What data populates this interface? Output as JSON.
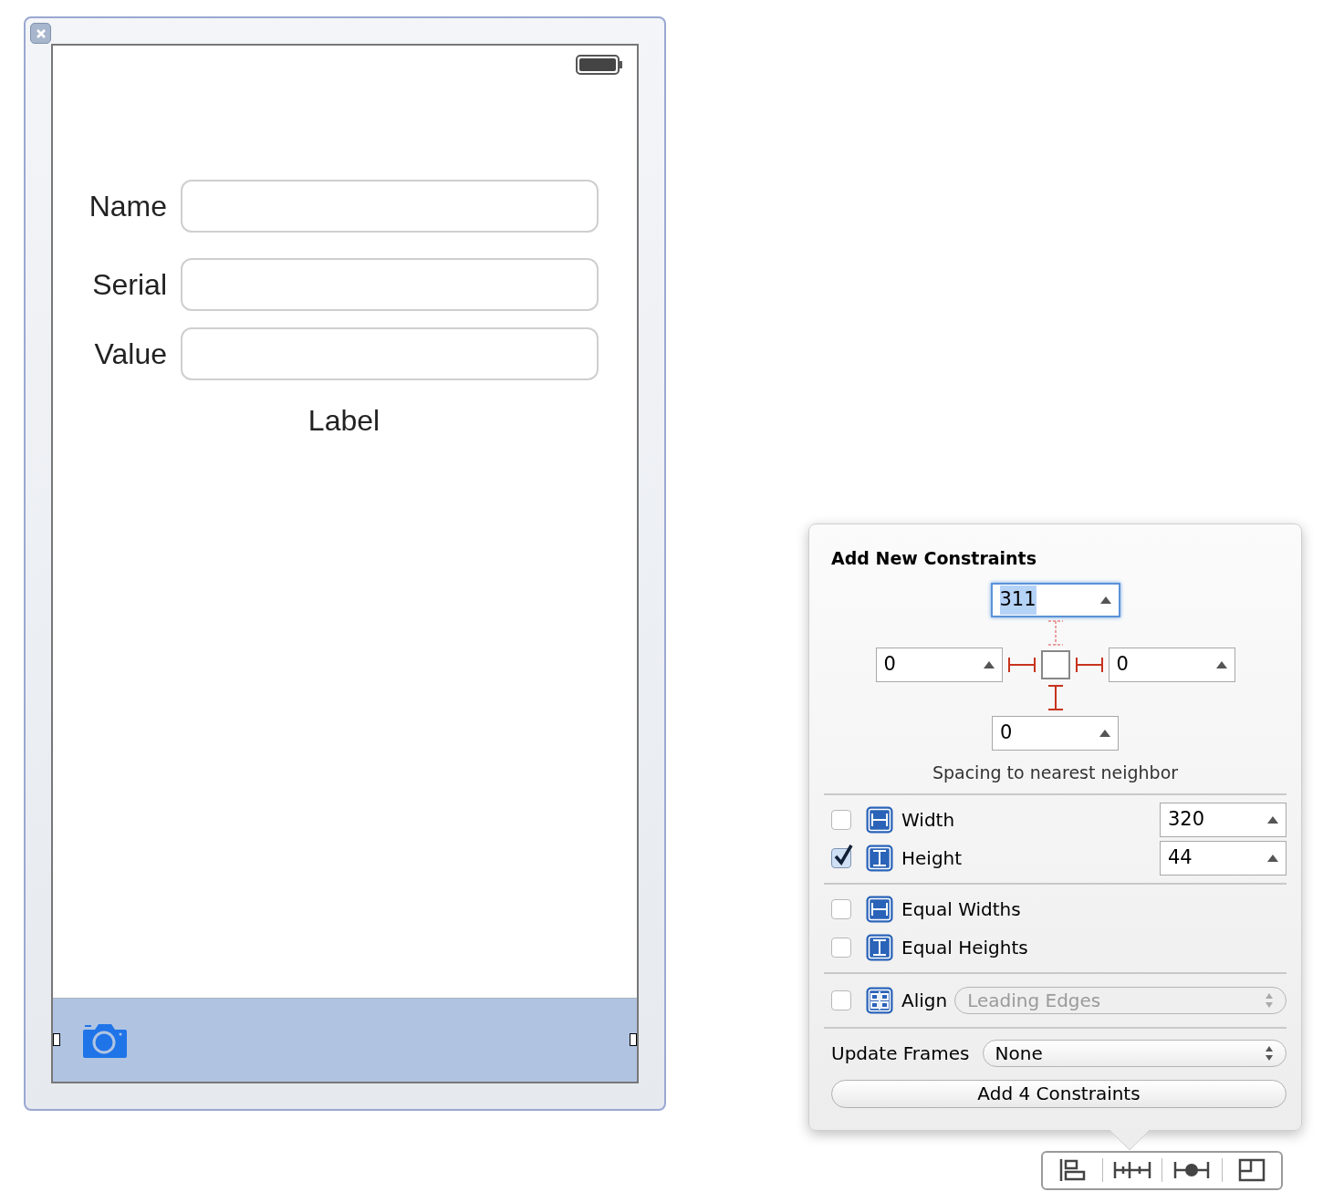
{
  "canvas": {
    "fields": [
      {
        "label": "Name"
      },
      {
        "label": "Serial"
      },
      {
        "label": "Value"
      }
    ],
    "label": "Label",
    "toolbar": {
      "selected": true
    }
  },
  "popover": {
    "title": "Add New Constraints",
    "spacing": {
      "top": {
        "value": "311",
        "focused": true,
        "active": false
      },
      "left": {
        "value": "0",
        "focused": false,
        "active": true
      },
      "right": {
        "value": "0",
        "focused": false,
        "active": true
      },
      "bottom": {
        "value": "0",
        "focused": false,
        "active": true
      }
    },
    "caption": "Spacing to nearest neighbor",
    "size_rows": [
      {
        "kind": "width",
        "label": "Width",
        "checked": false,
        "value": "320"
      },
      {
        "kind": "height",
        "label": "Height",
        "checked": true,
        "value": "44"
      }
    ],
    "equal_rows": [
      {
        "kind": "width",
        "label": "Equal Widths",
        "checked": false
      },
      {
        "kind": "height",
        "label": "Equal Heights",
        "checked": false
      }
    ],
    "align": {
      "label": "Align",
      "checked": false,
      "value": "Leading Edges",
      "disabled": true
    },
    "update_frames": {
      "label": "Update Frames",
      "value": "None"
    },
    "button": "Add 4 Constraints"
  }
}
